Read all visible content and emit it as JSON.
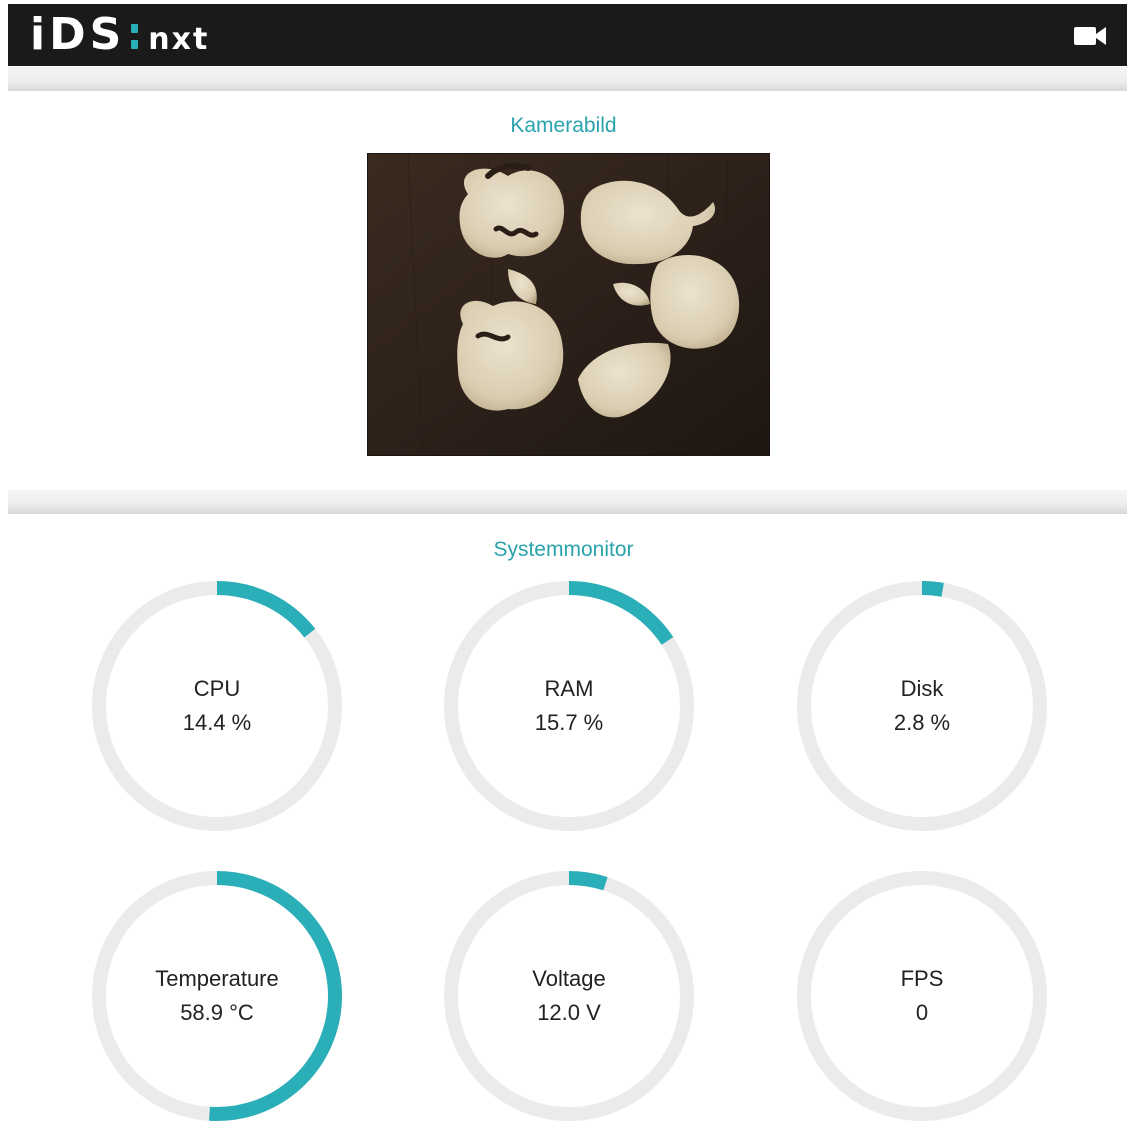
{
  "header": {
    "logo_main": "iDS",
    "logo_sub": "nxt",
    "camera_icon": "video-camera-icon"
  },
  "camera_section": {
    "title": "Kamerabild"
  },
  "monitor_section": {
    "title": "Systemmonitor",
    "gauges": [
      {
        "label": "CPU",
        "value_text": "14.4 %",
        "fraction": 0.144
      },
      {
        "label": "RAM",
        "value_text": "15.7 %",
        "fraction": 0.157
      },
      {
        "label": "Disk",
        "value_text": "2.8 %",
        "fraction": 0.028
      },
      {
        "label": "Temperature",
        "value_text": "58.9 °C",
        "fraction": 0.51
      },
      {
        "label": "Voltage",
        "value_text": "12.0 V",
        "fraction": 0.05
      },
      {
        "label": "FPS",
        "value_text": "0",
        "fraction": 0
      }
    ]
  },
  "colors": {
    "accent": "#2aaeb7",
    "track": "#ebebeb",
    "header_bg": "#1a1a1a"
  }
}
